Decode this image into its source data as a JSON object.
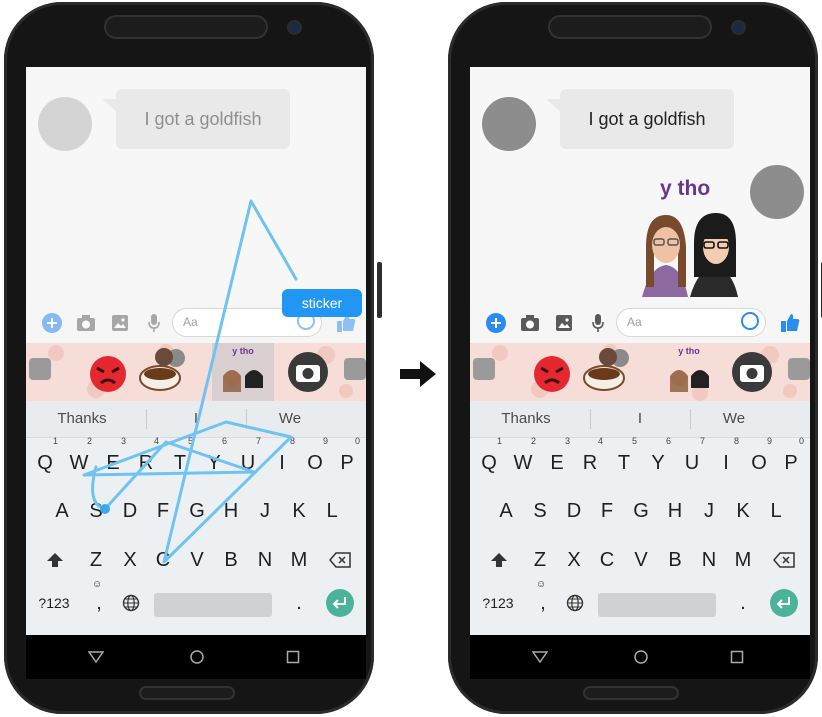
{
  "colors": {
    "messenger_blue": "#2196f3",
    "enter_green": "#4bb39a",
    "ytho_purple": "#6b3592",
    "gesture_line": "#6ec3f2"
  },
  "left": {
    "message": "I got a goldfish",
    "avatar_color": "#d4d4d4",
    "bubble_bg": "#e9e9e9",
    "bubble_text_color": "#8f8f8f",
    "sticker_hint": "sticker",
    "gesture": "swipe-trail"
  },
  "right": {
    "message": "I got a goldfish",
    "avatar_color": "#8d8d8d",
    "bubble_bg": "#e9e9e9",
    "bubble_text_color": "#222222",
    "sent_sticker_text": "y tho"
  },
  "compose": {
    "placeholder": "Aa"
  },
  "sticker_strip": {
    "selected_caption": "y tho",
    "stickers": [
      "angry-face-sticker",
      "coffee-cup-sticker",
      "y-tho-sticker",
      "camera-sticker"
    ]
  },
  "suggestions": [
    "Thanks",
    "I",
    "We"
  ],
  "keyboard": {
    "row1": [
      {
        "k": "Q",
        "h": "1"
      },
      {
        "k": "W",
        "h": "2"
      },
      {
        "k": "E",
        "h": "3"
      },
      {
        "k": "R",
        "h": "4"
      },
      {
        "k": "T",
        "h": "5"
      },
      {
        "k": "Y",
        "h": "6"
      },
      {
        "k": "U",
        "h": "7"
      },
      {
        "k": "I",
        "h": "8"
      },
      {
        "k": "O",
        "h": "9"
      },
      {
        "k": "P",
        "h": "0"
      }
    ],
    "row2": [
      "A",
      "S",
      "D",
      "F",
      "G",
      "H",
      "J",
      "K",
      "L"
    ],
    "row3": [
      "Z",
      "X",
      "C",
      "V",
      "B",
      "N",
      "M"
    ],
    "symbols_label": "?123",
    "comma": ",",
    "period": "."
  },
  "icons": {
    "add": "plus-icon",
    "camera": "camera-icon",
    "gallery": "image-icon",
    "mic": "mic-icon",
    "like": "thumbs-up-icon",
    "emoji": "smiley-icon",
    "nav_back": "back-icon",
    "nav_home": "home-icon",
    "nav_recents": "recents-icon"
  }
}
